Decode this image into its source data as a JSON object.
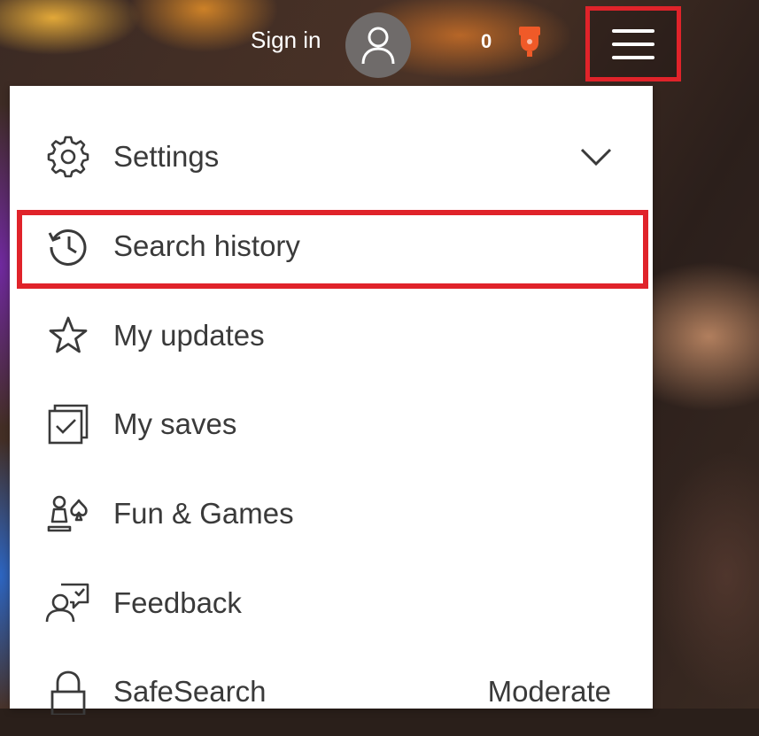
{
  "header": {
    "sign_in_label": "Sign in",
    "points": "0",
    "avatar_icon": "user-icon",
    "reward_icon": "trophy-icon",
    "menu_icon": "hamburger-icon"
  },
  "menu": {
    "items": [
      {
        "label": "Settings",
        "icon": "gear-icon"
      },
      {
        "label": "Search history",
        "icon": "history-icon"
      },
      {
        "label": "My updates",
        "icon": "star-icon"
      },
      {
        "label": "My saves",
        "icon": "saves-icon"
      },
      {
        "label": "Fun & Games",
        "icon": "games-icon"
      },
      {
        "label": "Feedback",
        "icon": "feedback-icon"
      },
      {
        "label": "SafeSearch",
        "icon": "lock-icon",
        "value": "Moderate"
      }
    ]
  },
  "colors": {
    "highlight": "#e0232a",
    "reward": "#f05a28",
    "text": "#3a3a3a"
  }
}
